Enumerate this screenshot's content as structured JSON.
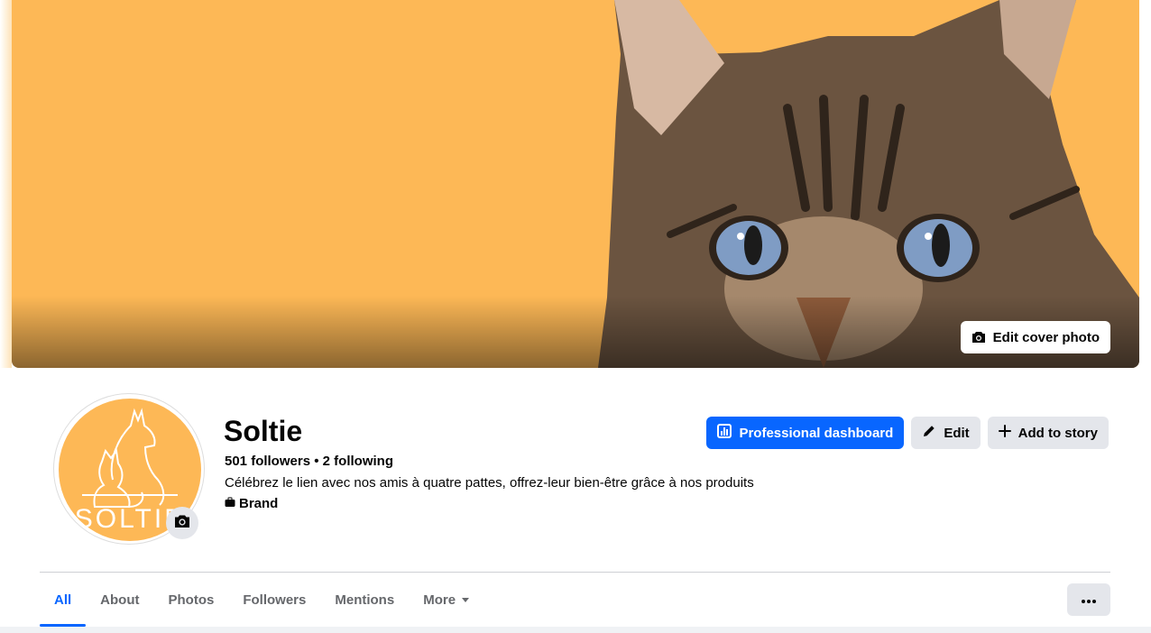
{
  "cover": {
    "edit_label": "Edit cover photo",
    "background_color": "#fdb856"
  },
  "profile": {
    "name": "Soltie",
    "followers": "501 followers",
    "separator": "•",
    "following": "2 following",
    "bio": "Célébrez le lien avec nos amis à quatre pattes, offrez-leur bien-être grâce à nos produits",
    "category": "Brand",
    "avatar_text": "SOLTIE"
  },
  "actions": {
    "dashboard_label": "Professional dashboard",
    "edit_label": "Edit",
    "add_story_label": "Add to story"
  },
  "tabs": [
    {
      "label": "All",
      "active": true
    },
    {
      "label": "About"
    },
    {
      "label": "Photos"
    },
    {
      "label": "Followers"
    },
    {
      "label": "Mentions"
    },
    {
      "label": "More"
    }
  ],
  "colors": {
    "accent": "#0866ff",
    "secondary_button": "#e4e6eb",
    "brand_orange": "#fdb856"
  },
  "icons": [
    "camera-icon",
    "dashboard-icon",
    "pencil-icon",
    "plus-icon",
    "briefcase-icon",
    "caret-down-icon",
    "ellipsis-icon"
  ]
}
